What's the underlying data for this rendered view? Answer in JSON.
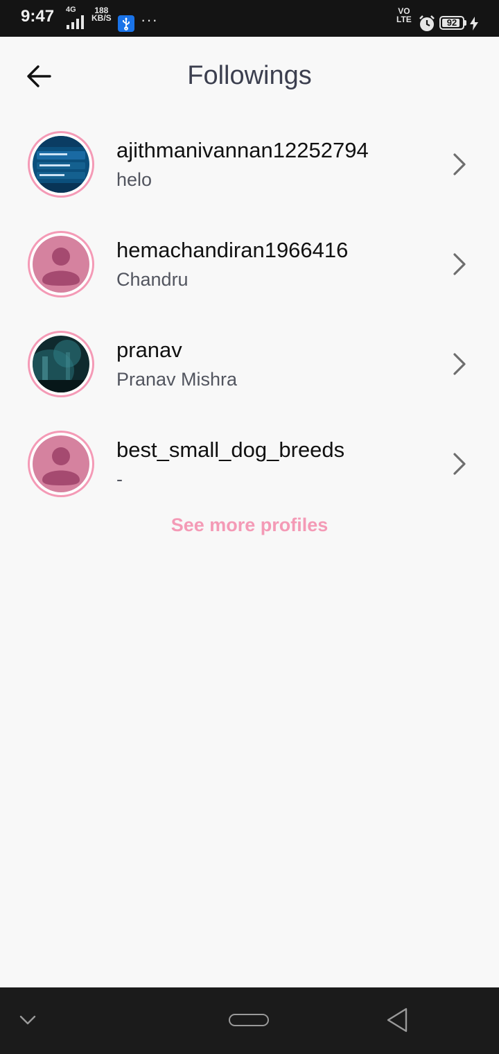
{
  "status_bar": {
    "time": "9:47",
    "network": "4G",
    "speed_value": "188",
    "speed_unit": "KB/S",
    "more": "···",
    "volte_top": "VO",
    "volte_bottom": "LTE",
    "battery": "92",
    "battery_level": 0.92,
    "icons": [
      "signal-icon",
      "usb-icon",
      "alarm-icon",
      "battery-icon",
      "charging-icon"
    ]
  },
  "header": {
    "title": "Followings",
    "back_icon": "back-arrow-icon"
  },
  "profiles": [
    {
      "username": "ajithmanivannan12252794",
      "name": "helo",
      "avatar": "photo-screenshot"
    },
    {
      "username": "hemachandiran1966416",
      "name": "Chandru",
      "avatar": "default-person"
    },
    {
      "username": "pranav",
      "name": "Pranav Mishra",
      "avatar": "photo-dark"
    },
    {
      "username": "best_small_dog_breeds",
      "name": "-",
      "avatar": "default-person"
    }
  ],
  "see_more": "See more profiles",
  "colors": {
    "accent": "#f49ab6",
    "placeholder_avatar": "#d5829f",
    "placeholder_figure": "#a54a70",
    "title": "#3c3f4f"
  },
  "nav_bar": {
    "icons": [
      "chevron-down-icon",
      "home-pill-icon",
      "back-triangle-icon"
    ]
  }
}
